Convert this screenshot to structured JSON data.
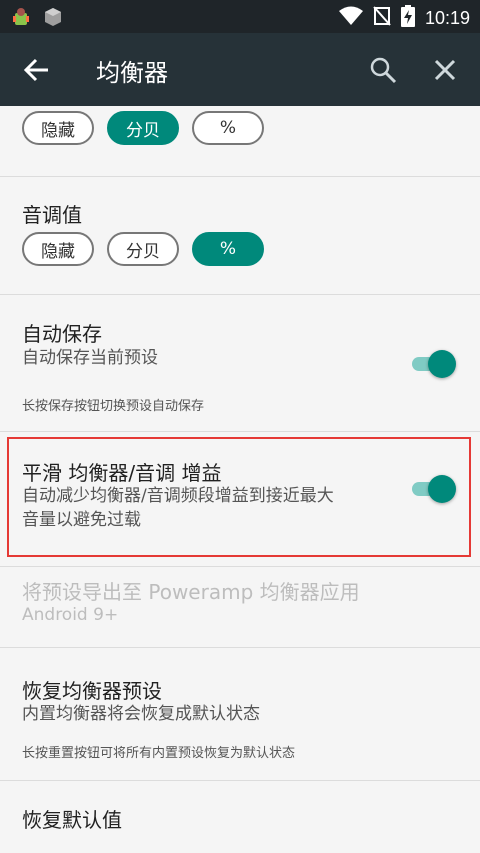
{
  "status_bar": {
    "time": "10:19",
    "icons": [
      "app-icon",
      "cube-icon",
      "wifi-icon",
      "no-sim-icon",
      "battery-charging-icon"
    ]
  },
  "appbar": {
    "title": "均衡器",
    "icons": [
      "back-arrow-icon",
      "search-icon",
      "close-icon"
    ]
  },
  "sections": {
    "top_display": {
      "options": [
        "隐藏",
        "分贝",
        "%"
      ],
      "selected": "分贝"
    },
    "tone_value": {
      "title": "音调值",
      "options": [
        "隐藏",
        "分贝",
        "%"
      ],
      "selected": "%"
    },
    "autosave": {
      "title": "自动保存",
      "subtitle": "自动保存当前预设",
      "note": "长按保存按钮切换预设自动保存",
      "enabled": true
    },
    "smooth_gain": {
      "title": "平滑 均衡器/音调 增益",
      "subtitle_line1": "自动减少均衡器/音调频段增益到接近最大",
      "subtitle_line2": "音量以避免过载",
      "enabled": true
    },
    "export_presets": {
      "title": "将预设导出至 Poweramp 均衡器应用",
      "subtitle": "Android 9+"
    },
    "restore_eq_presets": {
      "title": "恢复均衡器预设",
      "subtitle": "内置均衡器将会恢复成默认状态",
      "note": "长按重置按钮可将所有内置预设恢复为默认状态"
    },
    "restore_defaults": {
      "title": "恢复默认值"
    }
  },
  "colors": {
    "accent": "#00897b",
    "appbar": "#263238",
    "statusbar": "#1f2529",
    "highlight": "#e53935"
  }
}
